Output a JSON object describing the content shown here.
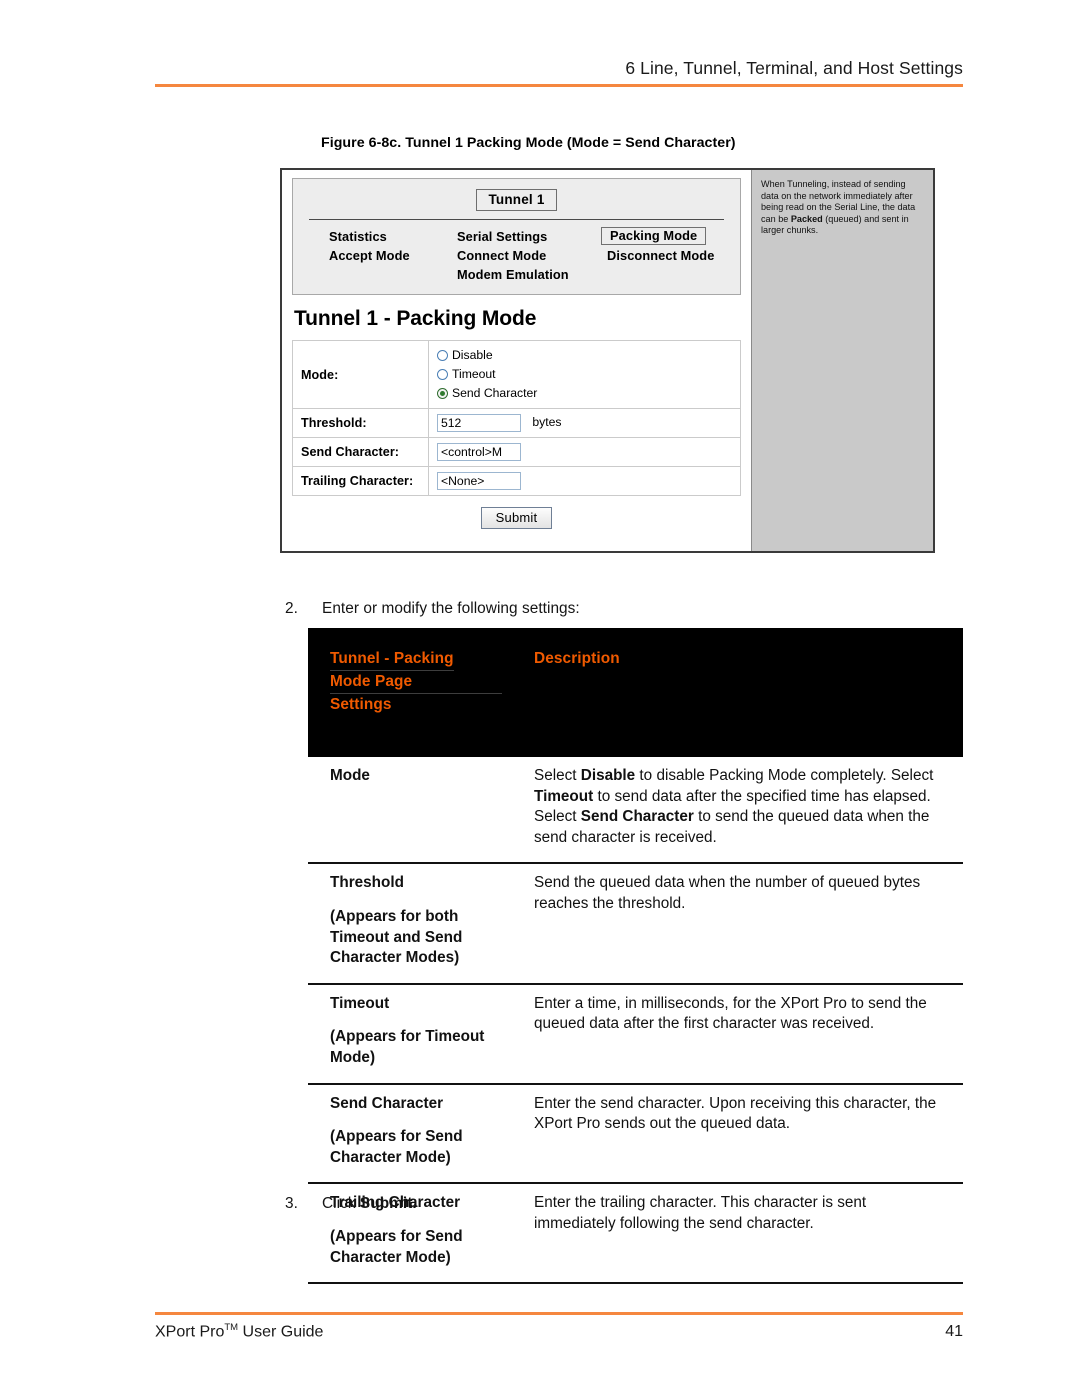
{
  "header": {
    "running_head": "6 Line, Tunnel, Terminal, and Host Settings"
  },
  "figure": {
    "caption": "Figure 6-8c. Tunnel 1 Packing Mode (Mode = Send Character)",
    "nav": {
      "tunnel_button": "Tunnel 1",
      "links": [
        "Statistics",
        "Serial Settings",
        "Packing Mode",
        "Accept Mode",
        "Connect Mode",
        "Disconnect Mode",
        "Modem Emulation"
      ],
      "active_link": "Packing Mode"
    },
    "page_title": "Tunnel 1 - Packing Mode",
    "form": {
      "mode_label": "Mode:",
      "mode_options": [
        {
          "label": "Disable",
          "selected": false
        },
        {
          "label": "Timeout",
          "selected": false
        },
        {
          "label": "Send Character",
          "selected": true
        }
      ],
      "threshold_label": "Threshold:",
      "threshold_value": "512",
      "threshold_unit": "bytes",
      "send_char_label": "Send Character:",
      "send_char_value": "<control>M",
      "trailing_char_label": "Trailing Character:",
      "trailing_char_value": "<None>",
      "submit_label": "Submit"
    },
    "help": {
      "part1": "When Tunneling, instead of sending data on the network immediately after being read on the Serial Line, the data can be ",
      "bold": "Packed",
      "part2": " (queued) and sent in larger chunks."
    }
  },
  "steps": {
    "step2_num": "2.",
    "step2_text": "Enter or modify the following settings:",
    "step3_num": "3.",
    "step3_text_pre": "Click ",
    "step3_text_bold": "Submit."
  },
  "table": {
    "header": {
      "col1_line1": "Tunnel -  Packing",
      "col1_line2": "Mode Page",
      "col1_line3": "Settings",
      "col2": "Description"
    },
    "rows": [
      {
        "name": "Mode",
        "sub": "",
        "desc_parts": [
          {
            "t": "Select ",
            "b": false
          },
          {
            "t": "Disable",
            "b": true
          },
          {
            "t": " to disable Packing Mode completely. Select ",
            "b": false
          },
          {
            "t": "Timeout",
            "b": true
          },
          {
            "t": " to send data after the specified time has elapsed. Select ",
            "b": false
          },
          {
            "t": "Send Character",
            "b": true
          },
          {
            "t": " to send the queued data when the send character is received.",
            "b": false
          }
        ]
      },
      {
        "name": "Threshold",
        "sub": "(Appears for both Timeout and Send Character Modes)",
        "desc_parts": [
          {
            "t": "Send the queued data when the number of queued bytes reaches the threshold.",
            "b": false
          }
        ]
      },
      {
        "name": "Timeout",
        "sub": "(Appears for Timeout Mode)",
        "desc_parts": [
          {
            "t": "Enter a time, in milliseconds, for the XPort Pro to send the queued data after the first character was received.",
            "b": false
          }
        ]
      },
      {
        "name": "Send Character",
        "sub": "(Appears for Send Character Mode)",
        "desc_parts": [
          {
            "t": "Enter the send character. Upon receiving this character, the XPort Pro sends out the queued data.",
            "b": false
          }
        ]
      },
      {
        "name": "Trailing Character",
        "sub": "(Appears for Send Character Mode)",
        "desc_parts": [
          {
            "t": "Enter the trailing character. This character is sent immediately following the send character.",
            "b": false
          }
        ]
      }
    ]
  },
  "footer": {
    "doc_title_pre": "XPort Pro",
    "doc_title_tm": "TM",
    "doc_title_post": " User Guide",
    "page_number": "41"
  },
  "colors": {
    "accent_orange": "#f05a00",
    "rule_orange": "#f5873f",
    "header_bg": "#000000"
  }
}
